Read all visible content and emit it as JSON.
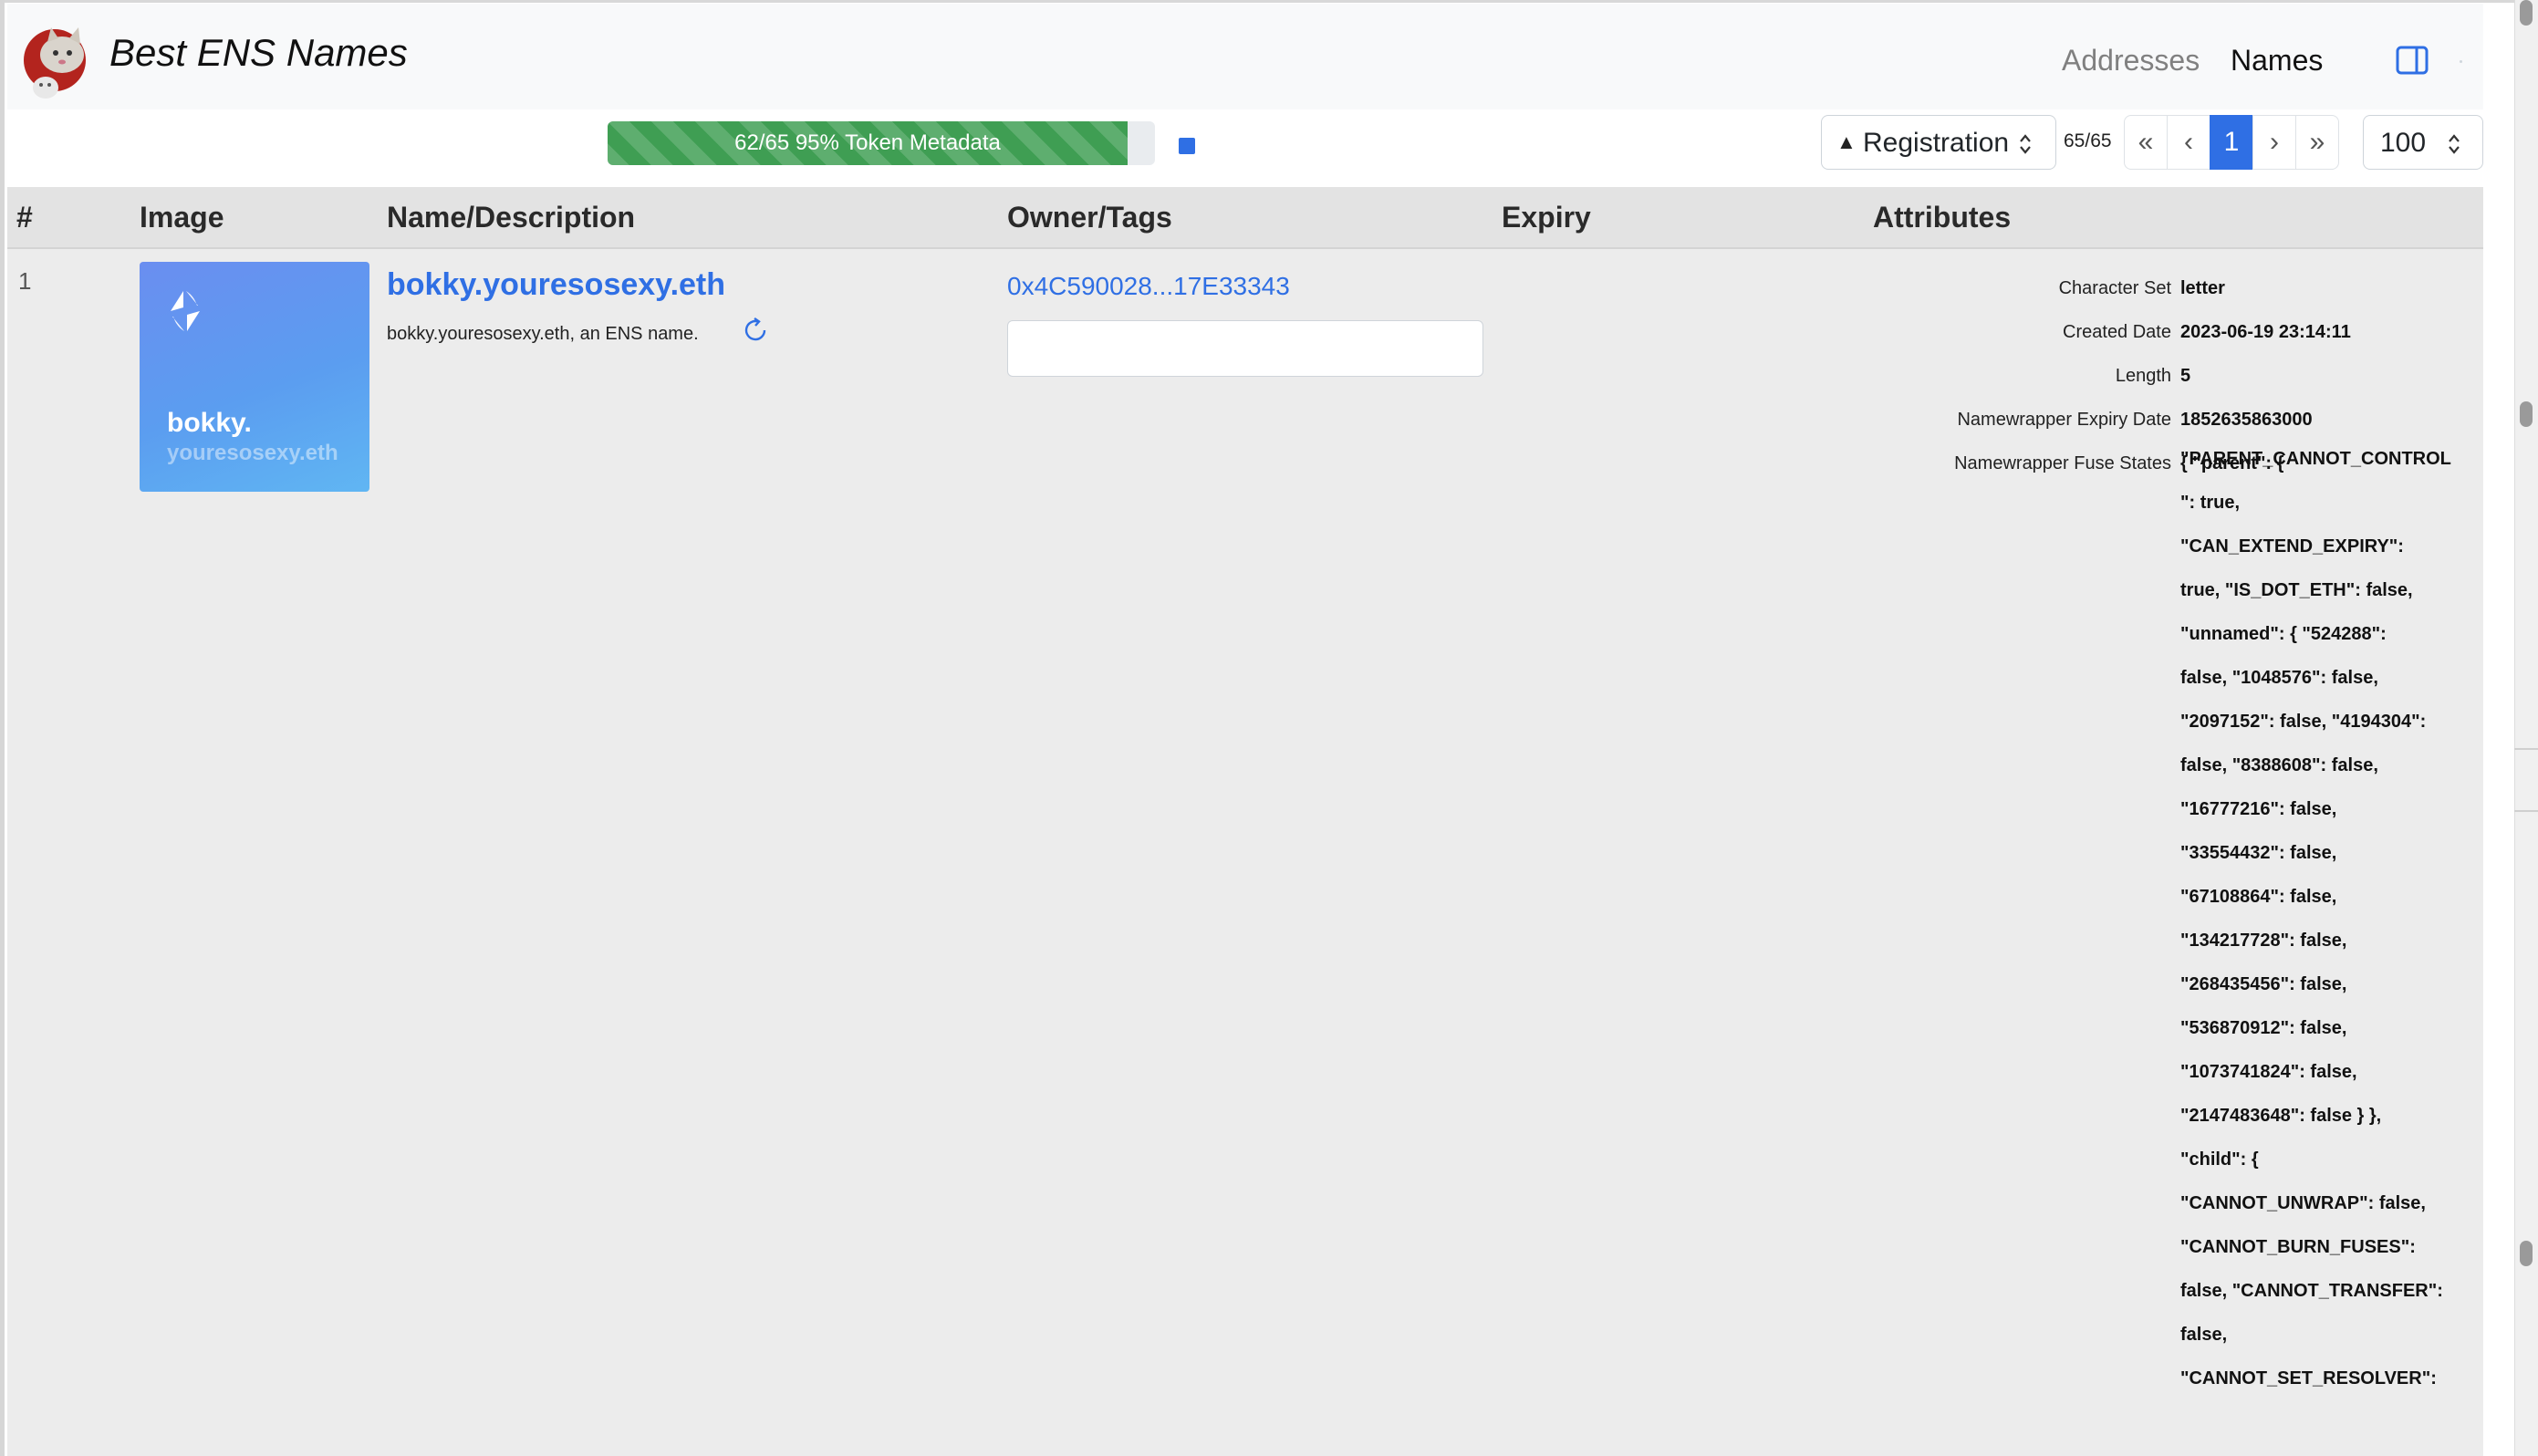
{
  "header": {
    "brand": "Best ENS Names",
    "nav": {
      "addresses": "Addresses",
      "names": "Names"
    }
  },
  "toolbar": {
    "progress": {
      "label": "62/65 95% Token Metadata",
      "fraction": 0.95
    },
    "sort": {
      "caret": "▲",
      "selected": "Registration"
    },
    "count": "65/65",
    "pagination": {
      "first": "«",
      "prev": "‹",
      "current": "1",
      "next": "›",
      "last": "»"
    },
    "page_size": "100"
  },
  "table": {
    "columns": [
      "#",
      "Image",
      "Name/Description",
      "Owner/Tags",
      "Expiry",
      "Attributes"
    ],
    "row": {
      "index": "1",
      "image": {
        "line1": "bokky.",
        "line2": "youresosexy.eth",
        "gradient": [
          "#6a8ef0",
          "#60b6f3"
        ]
      },
      "name": "bokky.youresosexy.eth",
      "description": "bokky.youresosexy.eth, an ENS name.",
      "owner": "0x4C590028...17E33343",
      "tags_value": "",
      "expiry": "",
      "attributes": [
        {
          "label": "Character Set",
          "value": "letter"
        },
        {
          "label": "Created Date",
          "value": "2023-06-19 23:14:11"
        },
        {
          "label": "Length",
          "value": "5"
        },
        {
          "label": "Namewrapper Expiry Date",
          "value": "1852635863000"
        },
        {
          "label": "Namewrapper Fuse States",
          "value": "{ \"parent\": {"
        }
      ],
      "fuse_lines": [
        "\"PARENT_CANNOT_CONTROL",
        "\": true,",
        "\"CAN_EXTEND_EXPIRY\":",
        "true, \"IS_DOT_ETH\": false,",
        "\"unnamed\": { \"524288\":",
        "false, \"1048576\": false,",
        "\"2097152\": false, \"4194304\":",
        "false, \"8388608\": false,",
        "\"16777216\": false,",
        "\"33554432\": false,",
        "\"67108864\": false,",
        "\"134217728\": false,",
        "\"268435456\": false,",
        "\"536870912\": false,",
        "\"1073741824\": false,",
        "\"2147483648\": false } },",
        "\"child\": {",
        "\"CANNOT_UNWRAP\": false,",
        "\"CANNOT_BURN_FUSES\":",
        "false, \"CANNOT_TRANSFER\":",
        "false,",
        "\"CANNOT_SET_RESOLVER\":"
      ]
    }
  },
  "icons": {
    "logo": "cat-logo-icon",
    "sidebar_toggle": "sidebar-toggle-icon",
    "ens": "ens-logo-icon",
    "refresh": "refresh-icon",
    "stop": "stop-icon",
    "sort_arrows": "up-down-arrows-icon"
  },
  "colors": {
    "accent": "#2f6fe4",
    "progress": "#3f9e53",
    "header_bg": "#f8f9fa",
    "table_bg": "#ececec"
  }
}
